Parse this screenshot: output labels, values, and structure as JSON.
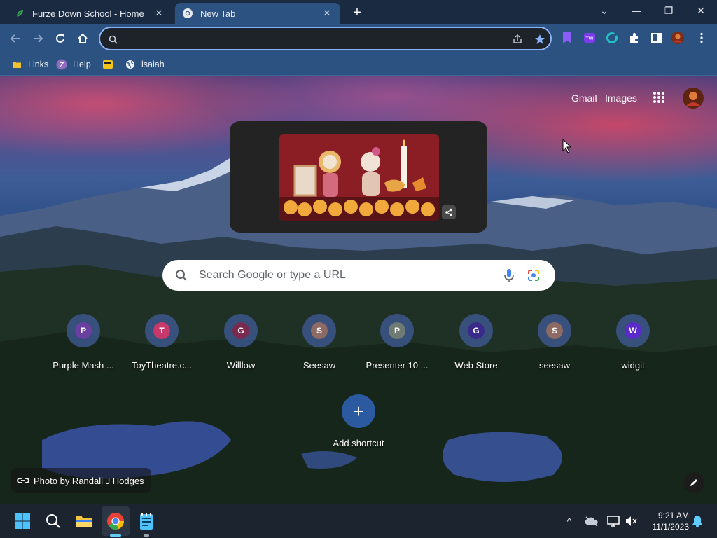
{
  "browser": {
    "tabs": [
      {
        "title": "Furze Down School - Home",
        "favicon": "leaf-icon",
        "active": false,
        "close": "✕"
      },
      {
        "title": "New Tab",
        "favicon": "chrome-icon",
        "active": true,
        "close": "✕"
      }
    ],
    "new_tab_symbol": "+",
    "window_controls": {
      "dropdown": "⌄",
      "minimize": "—",
      "restore": "❐",
      "close": "✕"
    },
    "omnibox": {
      "value": "",
      "placeholder": ""
    },
    "bookmarks": [
      {
        "label": "Links",
        "icon": "folder-icon"
      },
      {
        "label": "Help",
        "icon": "help-z-icon"
      },
      {
        "label": "",
        "icon": "bus-icon"
      },
      {
        "label": "isaiah",
        "icon": "globe-icon"
      }
    ]
  },
  "ntp": {
    "header_links": {
      "gmail": "Gmail",
      "images": "Images"
    },
    "search": {
      "placeholder": "Search Google or type a URL"
    },
    "shortcuts": [
      {
        "label": "Purple Mash ...",
        "letter": "P",
        "color": "#6a3fa0"
      },
      {
        "label": "ToyTheatre.c...",
        "letter": "T",
        "color": "#c9386b"
      },
      {
        "label": "Willlow",
        "letter": "G",
        "color": "#7a2a4e"
      },
      {
        "label": "Seesaw",
        "letter": "S",
        "color": "#8d6a63"
      },
      {
        "label": "Presenter 10 ...",
        "letter": "P",
        "color": "#6e7a72"
      },
      {
        "label": "Web Store",
        "letter": "G",
        "color": "#3a2a8a"
      },
      {
        "label": "seesaw",
        "letter": "S",
        "color": "#8d6a63"
      },
      {
        "label": "widgit",
        "letter": "W",
        "color": "#5a2acb"
      }
    ],
    "add_shortcut": {
      "symbol": "+",
      "label": "Add shortcut"
    },
    "attribution": "Photo by Randall J Hodges"
  },
  "taskbar": {
    "clock": {
      "time": "9:21 AM",
      "date": "11/1/2023"
    },
    "tray_chevron": "^"
  }
}
